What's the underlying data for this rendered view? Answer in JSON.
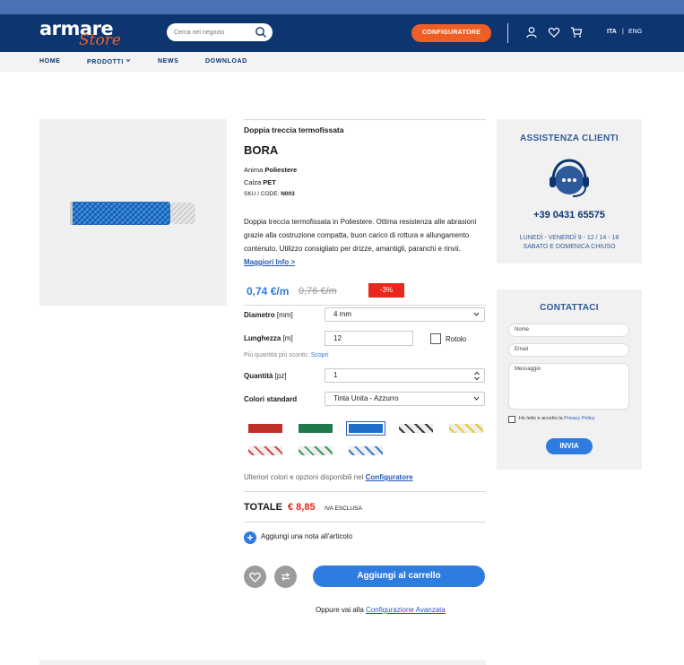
{
  "header": {
    "logo_main": "armare",
    "logo_sub": "Store",
    "search_placeholder": "Cerca nel negozio",
    "configurator_button": "CONFIGURATORE",
    "lang_active": "ITA",
    "lang_separator": "|",
    "lang_other": "ENG"
  },
  "nav": {
    "items": [
      "HOME",
      "PRODOTTI",
      "NEWS",
      "DOWNLOAD"
    ]
  },
  "product": {
    "subtitle": "Doppia treccia termofissata",
    "name": "BORA",
    "core_label": "Anima",
    "core_value": "Poliestere",
    "cover_label": "Calza",
    "cover_value": "PET",
    "sku_label": "SKU / CODE:",
    "sku_value": "N003",
    "description": "Doppia treccia termofissata in Poliestere. Ottima resistenza alle abrasioni grazie alla costruzione compatta, buon carico di rottura e allungamento contenuto. Utilizzo consigliato per drizze, amantigli, paranchi e rinvii.",
    "more_info": "Maggiori Info >",
    "price": "0,74 €/m",
    "old_price": "0,76 €/m",
    "discount": "-3%"
  },
  "form": {
    "diameter_label": "Diametro",
    "diameter_unit": "[mm]",
    "diameter_value": "4 mm",
    "length_label": "Lunghezza",
    "length_unit": "[m]",
    "length_value": "12",
    "roll_label": "Rotolo",
    "hint_text": "Più quantità più sconto.",
    "hint_link": "Scopri",
    "quantity_label": "Quantità",
    "quantity_unit": "[pz]",
    "quantity_value": "1",
    "colors_label": "Colori standard",
    "colors_value": "Tinta Unita - Azzurro",
    "more_text": "Ulteriori colori e opzioni disponibili nel",
    "more_link": "Configuratore"
  },
  "swatches": [
    {
      "name": "red",
      "color": "#c0302a",
      "selected": false
    },
    {
      "name": "green",
      "color": "#1e7a4a",
      "selected": false
    },
    {
      "name": "blue",
      "color": "#1f6fc8",
      "selected": true
    },
    {
      "name": "black-white",
      "color": "#333333",
      "selected": false
    },
    {
      "name": "yellow",
      "color": "#e8c82a",
      "selected": false
    },
    {
      "name": "white-red",
      "color": "#d84a4a",
      "selected": false
    },
    {
      "name": "white-green",
      "color": "#3a9a5a",
      "selected": false
    },
    {
      "name": "white-blue",
      "color": "#3a7ad0",
      "selected": false
    }
  ],
  "total": {
    "label": "TOTALE",
    "value": "€ 8,85",
    "vat": "IVA ESCLUSA"
  },
  "actions": {
    "note": "Aggiungi una nota all'articolo",
    "add_to_cart": "Aggiungi al carrello",
    "alt_text": "Oppure vai alla",
    "alt_link": "Configurazione Avanzata"
  },
  "support": {
    "title": "ASSISTENZA CLIENTI",
    "phone": "+39 0431 65575",
    "hours_1": "LUNEDÌ - VENERDÌ 9 - 12 / 14 - 18",
    "hours_2": "SABATO E DOMENICA CHIUSO"
  },
  "contact": {
    "title": "CONTATTACI",
    "name_placeholder": "Nome",
    "email_placeholder": "Email",
    "message_placeholder": "Messaggio",
    "privacy_text": "Ho letto e accetto la",
    "privacy_link": "Privacy Policy",
    "submit": "INVIA"
  },
  "colors": {
    "header_bg": "#0d3570",
    "top_strip": "#4a73b5",
    "accent_orange": "#ef5f25",
    "accent_blue": "#2f7ce0",
    "price_red": "#e0281c"
  }
}
